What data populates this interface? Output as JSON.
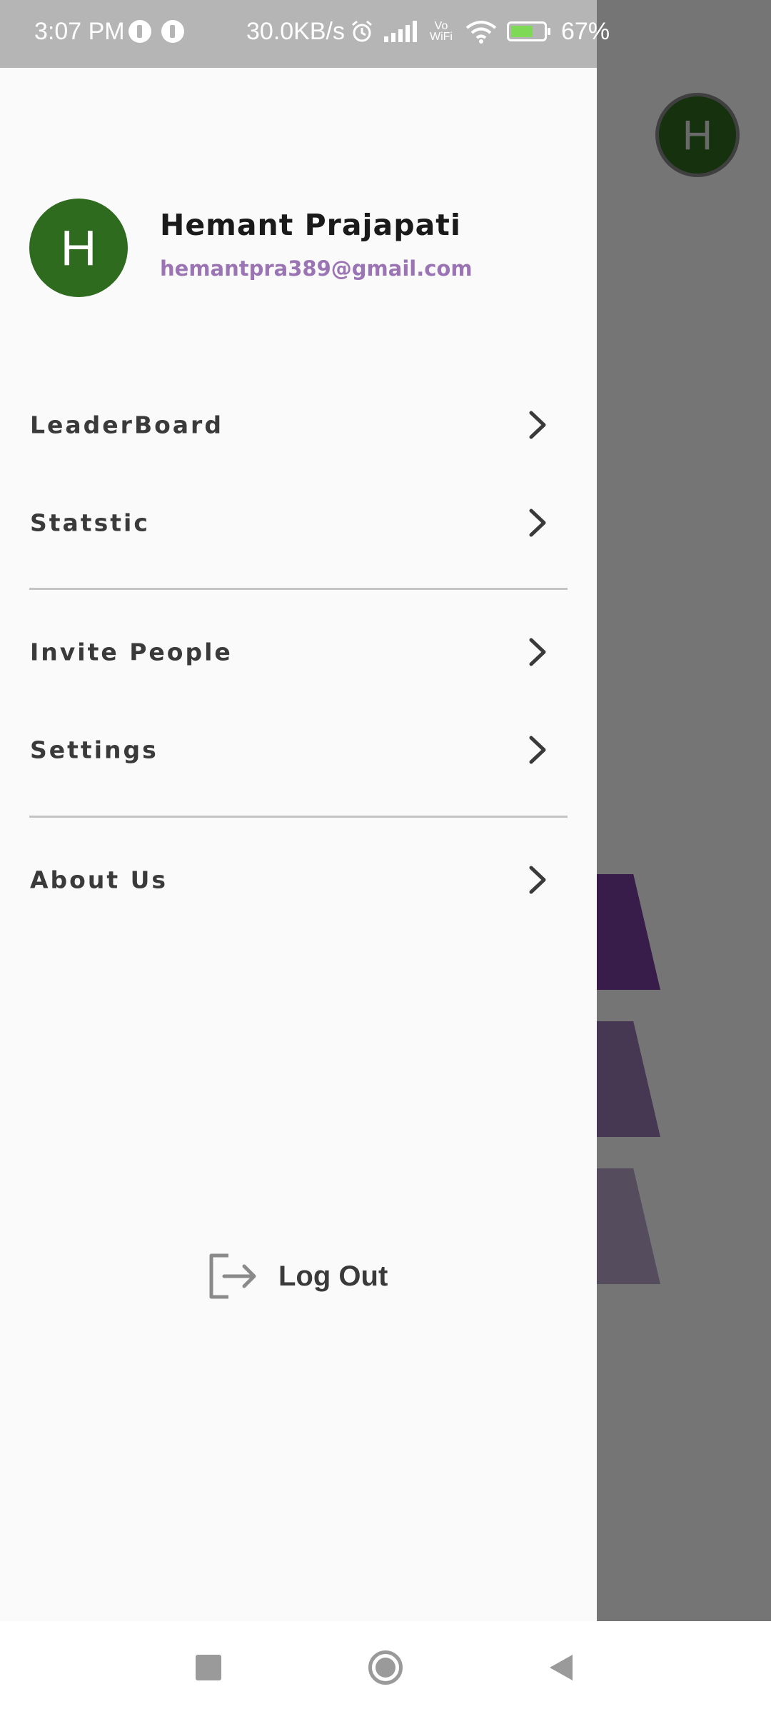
{
  "status_bar": {
    "time": "3:07 PM",
    "network_speed": "30.0KB/s",
    "vowifi_label": "Vo WiFi",
    "battery_percent": "67%"
  },
  "background": {
    "avatar_initial": "H",
    "avatar_color": "#2e6b1f"
  },
  "drawer": {
    "profile": {
      "initial": "H",
      "name": "Hemant Prajapati",
      "email": "hemantpra389@gmail.com"
    },
    "menu": [
      {
        "label": "LeaderBoard"
      },
      {
        "label": "Statstic"
      },
      {
        "label": "Invite People"
      },
      {
        "label": "Settings"
      },
      {
        "label": "About Us"
      }
    ],
    "logout_label": "Log Out"
  },
  "colors": {
    "avatar_green": "#2e6b1f",
    "email_purple": "#9b74b4",
    "text_dark": "#3a3a3a"
  }
}
